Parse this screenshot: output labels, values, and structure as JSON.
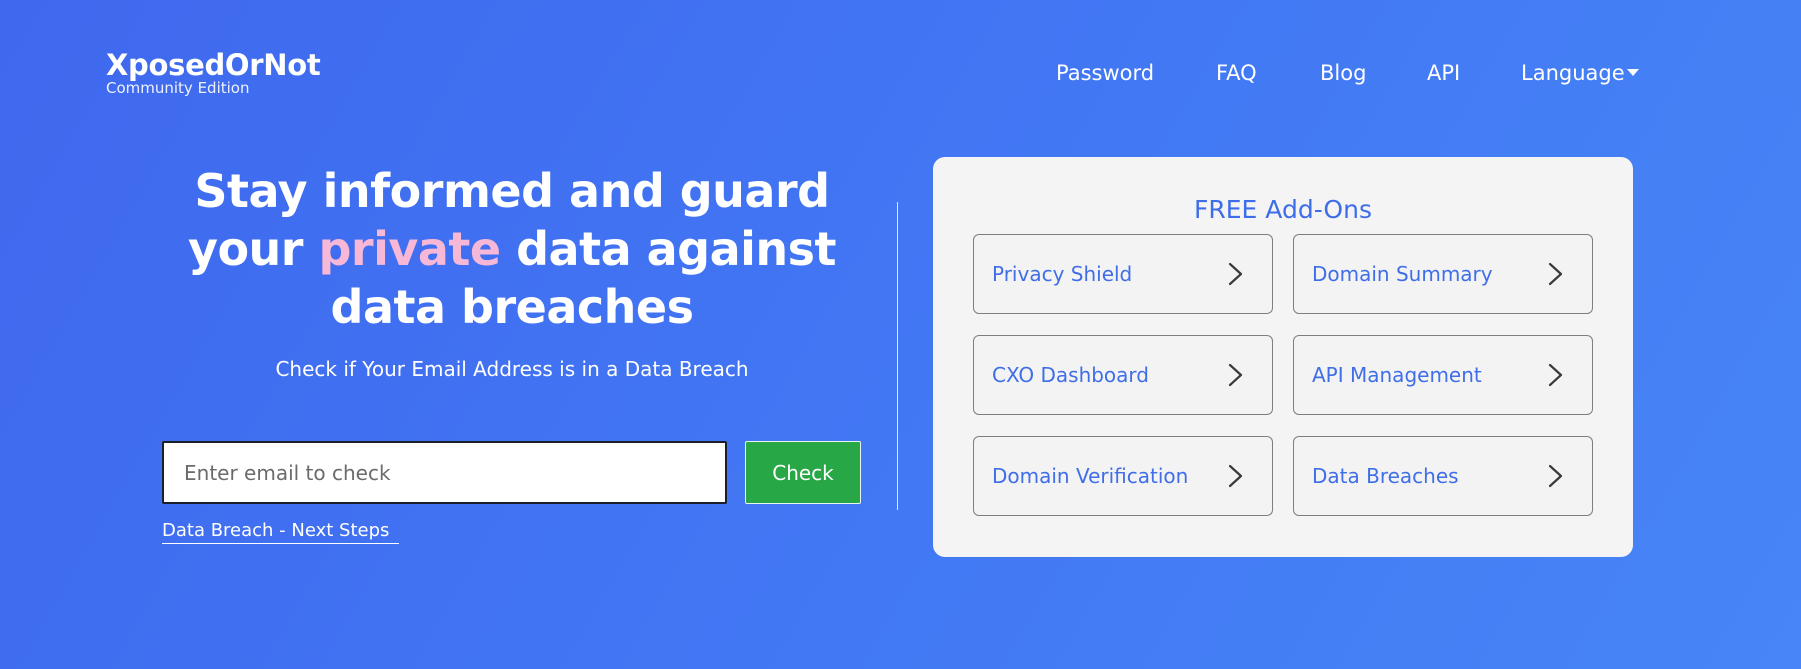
{
  "brand": {
    "name": "XposedOrNot",
    "subtitle": "Community Edition"
  },
  "nav": {
    "items": [
      {
        "label": "Password"
      },
      {
        "label": "FAQ"
      },
      {
        "label": "Blog"
      },
      {
        "label": "API"
      },
      {
        "label": "Language",
        "icon": "caret-down-icon"
      }
    ]
  },
  "hero": {
    "headline_part1": "Stay informed and guard",
    "headline_part2": "your ",
    "headline_accent": "private",
    "headline_part3": " data against",
    "headline_part4": "data breaches",
    "accent_color": "#f7b7d6",
    "subtitle": "Check if Your Email Address is in a Data Breach"
  },
  "search": {
    "placeholder": "Enter email to check",
    "value": "",
    "button_label": "Check",
    "button_color": "#27a745",
    "next_steps_link": "Data Breach - Next Steps"
  },
  "addons": {
    "title": "FREE Add-Ons",
    "accent_color": "#3f6ee8",
    "items": [
      {
        "label": "Privacy Shield",
        "icon": "chevron-right-icon"
      },
      {
        "label": "Domain Summary",
        "icon": "chevron-right-icon"
      },
      {
        "label": "CXO Dashboard",
        "icon": "chevron-right-icon"
      },
      {
        "label": "API Management",
        "icon": "chevron-right-icon"
      },
      {
        "label": "Domain Verification",
        "icon": "chevron-right-icon"
      },
      {
        "label": "Data Breaches",
        "icon": "chevron-right-icon"
      }
    ]
  }
}
